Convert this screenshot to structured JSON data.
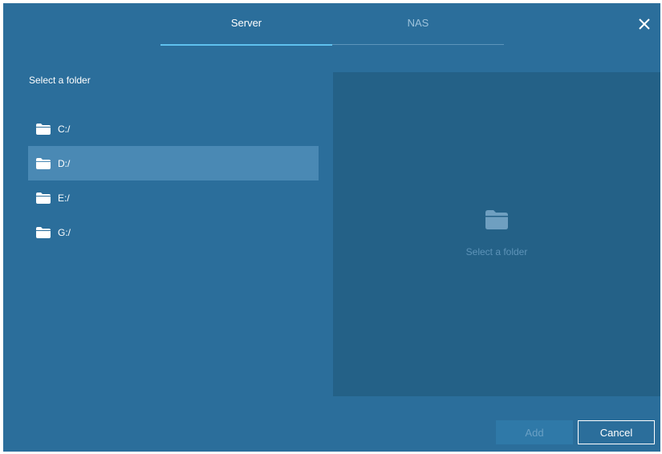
{
  "tabs": [
    {
      "label": "Server",
      "active": true
    },
    {
      "label": "NAS",
      "active": false
    }
  ],
  "close_icon": "close-icon",
  "left_panel": {
    "title": "Select a folder",
    "folders": [
      {
        "label": "C:/",
        "icon": "folder-icon",
        "selected": false
      },
      {
        "label": "D:/",
        "icon": "folder-icon",
        "selected": true
      },
      {
        "label": "E:/",
        "icon": "folder-icon",
        "selected": false
      },
      {
        "label": "G:/",
        "icon": "folder-icon",
        "selected": false
      }
    ]
  },
  "right_panel": {
    "placeholder_icon": "folder-icon",
    "placeholder_text": "Select a folder"
  },
  "footer": {
    "add_label": "Add",
    "cancel_label": "Cancel"
  },
  "colors": {
    "background": "#2b6e9b",
    "panel": "#246187",
    "selected_row": "#4a89b4",
    "tab_accent": "#5fc1ee"
  }
}
